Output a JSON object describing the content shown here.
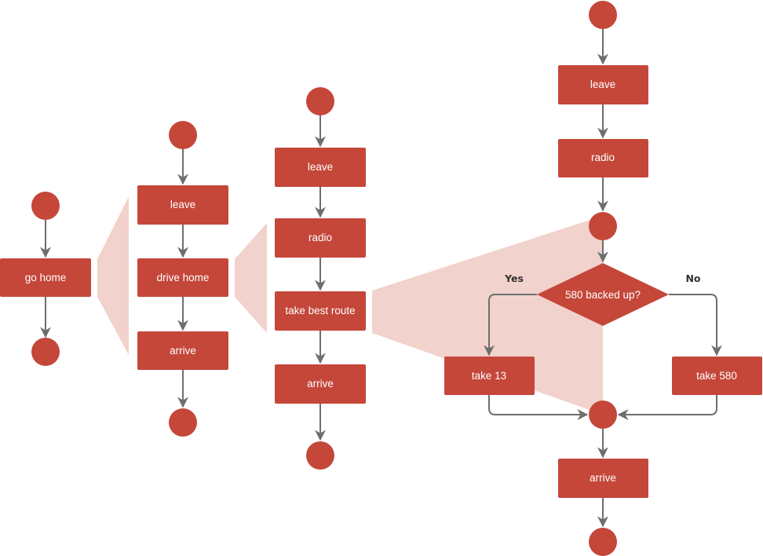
{
  "colors": {
    "node": "#c4473a",
    "expansion": "#f2d2cc",
    "edge": "#6e6e6e",
    "label": "#333333"
  },
  "levels": [
    {
      "id": "level-1",
      "nodes": [
        {
          "id": "l1-start",
          "type": "start"
        },
        {
          "id": "l1-go-home",
          "type": "action",
          "label": "go home"
        },
        {
          "id": "l1-end",
          "type": "end"
        }
      ]
    },
    {
      "id": "level-2",
      "expands": "l1-go-home",
      "nodes": [
        {
          "id": "l2-start",
          "type": "start"
        },
        {
          "id": "l2-leave",
          "type": "action",
          "label": "leave"
        },
        {
          "id": "l2-drive-home",
          "type": "action",
          "label": "drive home"
        },
        {
          "id": "l2-arrive",
          "type": "action",
          "label": "arrive"
        },
        {
          "id": "l2-end",
          "type": "end"
        }
      ]
    },
    {
      "id": "level-3",
      "expands": "l2-drive-home",
      "nodes": [
        {
          "id": "l3-start",
          "type": "start"
        },
        {
          "id": "l3-leave",
          "type": "action",
          "label": "leave"
        },
        {
          "id": "l3-radio",
          "type": "action",
          "label": "radio"
        },
        {
          "id": "l3-take-best-route",
          "type": "action",
          "label": "take best route"
        },
        {
          "id": "l3-arrive",
          "type": "action",
          "label": "arrive"
        },
        {
          "id": "l3-end",
          "type": "end"
        }
      ]
    },
    {
      "id": "level-4",
      "expands": "l3-take-best-route",
      "nodes": [
        {
          "id": "l4-start",
          "type": "start"
        },
        {
          "id": "l4-leave",
          "type": "action",
          "label": "leave"
        },
        {
          "id": "l4-radio",
          "type": "action",
          "label": "radio"
        },
        {
          "id": "l4-branch-start",
          "type": "junction"
        },
        {
          "id": "l4-decision",
          "type": "decision",
          "label": "580 backed up?"
        },
        {
          "id": "l4-take-13",
          "type": "action",
          "label": "take 13"
        },
        {
          "id": "l4-take-580",
          "type": "action",
          "label": "take 580"
        },
        {
          "id": "l4-merge",
          "type": "junction"
        },
        {
          "id": "l4-arrive",
          "type": "action",
          "label": "arrive"
        },
        {
          "id": "l4-end",
          "type": "end"
        }
      ]
    }
  ],
  "edges": [
    {
      "from": "l1-start",
      "to": "l1-go-home"
    },
    {
      "from": "l1-go-home",
      "to": "l1-end"
    },
    {
      "from": "l2-start",
      "to": "l2-leave"
    },
    {
      "from": "l2-leave",
      "to": "l2-drive-home"
    },
    {
      "from": "l2-drive-home",
      "to": "l2-arrive"
    },
    {
      "from": "l2-arrive",
      "to": "l2-end"
    },
    {
      "from": "l3-start",
      "to": "l3-leave"
    },
    {
      "from": "l3-leave",
      "to": "l3-radio"
    },
    {
      "from": "l3-radio",
      "to": "l3-take-best-route"
    },
    {
      "from": "l3-take-best-route",
      "to": "l3-arrive"
    },
    {
      "from": "l3-arrive",
      "to": "l3-end"
    },
    {
      "from": "l4-start",
      "to": "l4-leave"
    },
    {
      "from": "l4-leave",
      "to": "l4-radio"
    },
    {
      "from": "l4-radio",
      "to": "l4-branch-start"
    },
    {
      "from": "l4-branch-start",
      "to": "l4-decision"
    },
    {
      "from": "l4-decision",
      "to": "l4-take-13",
      "label": "Yes"
    },
    {
      "from": "l4-decision",
      "to": "l4-take-580",
      "label": "No"
    },
    {
      "from": "l4-take-13",
      "to": "l4-merge"
    },
    {
      "from": "l4-take-580",
      "to": "l4-merge"
    },
    {
      "from": "l4-merge",
      "to": "l4-arrive"
    },
    {
      "from": "l4-arrive",
      "to": "l4-end"
    }
  ],
  "edge_labels": {
    "yes": "Yes",
    "no": "No"
  }
}
